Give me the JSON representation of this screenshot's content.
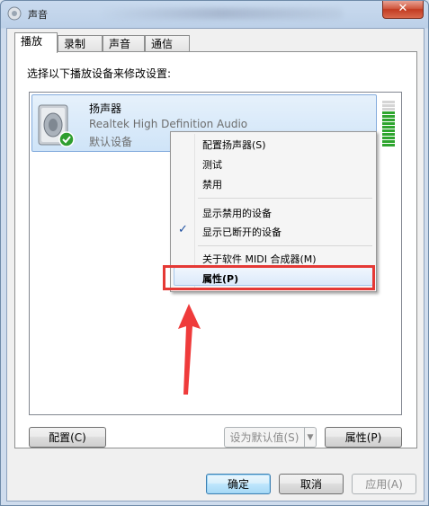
{
  "window": {
    "title": "声音",
    "close_symbol": "✕"
  },
  "tabs": [
    {
      "label": "播放",
      "active": true
    },
    {
      "label": "录制",
      "active": false
    },
    {
      "label": "声音",
      "active": false
    },
    {
      "label": "通信",
      "active": false
    }
  ],
  "playback": {
    "instruction": "选择以下播放设备来修改设置:",
    "device": {
      "name": "扬声器",
      "description": "Realtek High Definition Audio",
      "status": "默认设备",
      "icon": "speaker-icon",
      "status_icon": "checkmark-badge-icon",
      "level_fraction": 0.8
    }
  },
  "context_menu": {
    "items": [
      {
        "label": "配置扬声器(S)"
      },
      {
        "label": "测试"
      },
      {
        "label": "禁用"
      },
      {
        "label": "显示禁用的设备"
      },
      {
        "label": "显示已断开的设备",
        "checked": true
      },
      {
        "label": "关于软件 MIDI 合成器(M)"
      },
      {
        "label": "属性(P)",
        "highlighted": true
      }
    ],
    "check_mark": "✓"
  },
  "panel_buttons": {
    "configure": "配置(C)",
    "set_default": "设为默认值(S)",
    "properties": "属性(P)"
  },
  "dialog_buttons": {
    "ok": "确定",
    "cancel": "取消",
    "apply": "应用(A)"
  },
  "annotation": {
    "highlight_color": "#e53935"
  }
}
